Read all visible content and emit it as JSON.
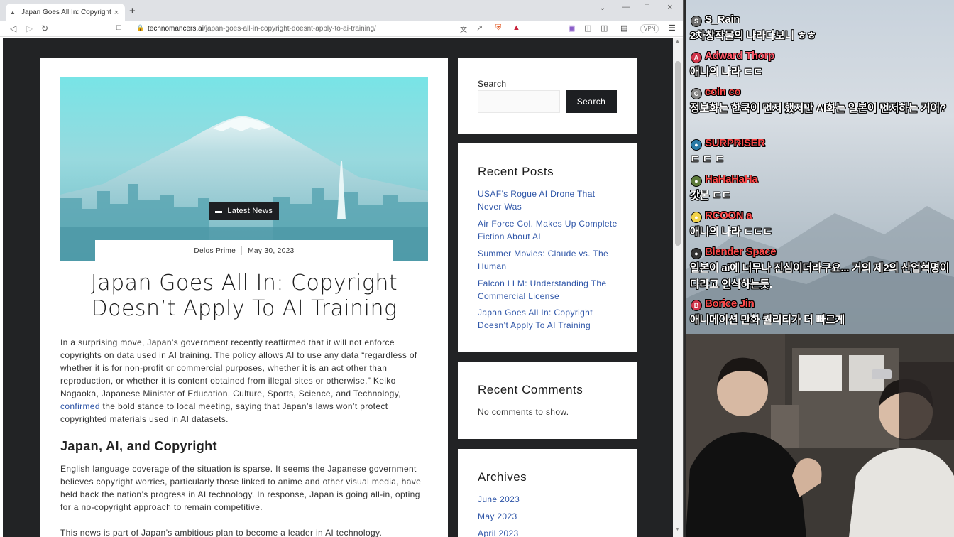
{
  "browser": {
    "tab_title": "Japan Goes All In: Copyright Doesn't Apply to AI Training",
    "new_tab_label": "+",
    "url_domain": "technomancers.ai",
    "url_path": "/japan-goes-all-in-copyright-doesnt-apply-to-ai-training/",
    "vpn_label": "VPN"
  },
  "article": {
    "category": "Latest News",
    "author": "Delos Prime",
    "date": "May 30, 2023",
    "title": "Japan Goes All In: Copyright Doesn’t Apply To AI Training",
    "p1_before_link": "In a surprising move, Japan’s government recently reaffirmed that it will not enforce copyrights on data used in AI training. The policy allows AI to use any data “regardless of whether it is for non-profit or commercial purposes, whether it is an act other than reproduction, or whether it is content obtained from illegal sites or otherwise.” Keiko Nagaoka, Japanese Minister of Education, Culture, Sports, Science, and Technology, ",
    "p1_link": "confirmed",
    "p1_after_link": " the bold stance to local meeting, saying that Japan’s laws won’t protect copyrighted materials used in AI datasets.",
    "h2": "Japan, AI, and Copyright",
    "p2": "English language coverage of the situation is sparse. It seems the Japanese government believes copyright worries, particularly those linked to anime and other visual media, have held back the nation’s progress in AI technology. In response, Japan is going all-in, opting for a no-copyright approach to remain competitive.",
    "p3": "This news is part of Japan’s ambitious plan to become a leader in AI technology."
  },
  "sidebar": {
    "search_label": "Search",
    "search_button": "Search",
    "search_placeholder": "",
    "recent_posts_title": "Recent Posts",
    "recent_posts": [
      "USAF’s Rogue AI Drone That Never Was",
      "Air Force Col. Makes Up Complete Fiction About AI",
      "Summer Movies: Claude vs. The Human",
      "Falcon LLM: Understanding The Commercial License",
      "Japan Goes All In: Copyright Doesn’t Apply To AI Training"
    ],
    "recent_comments_title": "Recent Comments",
    "recent_comments_text": "No comments to show.",
    "archives_title": "Archives",
    "archives": [
      "June 2023",
      "May 2023",
      "April 2023"
    ]
  },
  "chat": [
    {
      "avatar": "S",
      "avatar_color": "#6b6b6b",
      "name": "S_Rain",
      "name_color": "#ffffff",
      "msg": "2차창작물의 나라다보니 ㅎㅎ"
    },
    {
      "avatar": "A",
      "avatar_color": "#d0354b",
      "name": "Adward Thorp",
      "name_color": "#ff5a6a",
      "msg": "애니의 나라 ㄷㄷ"
    },
    {
      "avatar": "C",
      "avatar_color": "#888888",
      "name": "coin co",
      "name_color": "#ff4a4a",
      "msg": "정보화는 한국이 먼저 했지만 AI화는 일본이 먼저하는 거어?"
    },
    {
      "avatar": "●",
      "avatar_color": "#2a7aa6",
      "name": "SURPRISER",
      "name_color": "#ff4a4a",
      "msg": "ㄷ ㄷ ㄷ"
    },
    {
      "avatar": "●",
      "avatar_color": "#5c7a3a",
      "name": "HaHaHaHa",
      "name_color": "#ff4a4a",
      "msg": "갓본 ㄷㄷ"
    },
    {
      "avatar": "●",
      "avatar_color": "#f2d34a",
      "name": "RCOON a",
      "name_color": "#ff4a4a",
      "msg": "애니의 나라 ㄷㄷㄷ"
    },
    {
      "avatar": "●",
      "avatar_color": "#333333",
      "name": "Blender Space",
      "name_color": "#ff4a4a",
      "msg": "일본이 ai에 너무나 진심이더라구요... 거의 제2의 산업혁명이다라고 인식하는듯."
    },
    {
      "avatar": "B",
      "avatar_color": "#d0354b",
      "name": "Borice Jin",
      "name_color": "#ff4a4a",
      "msg": "애니메이션 만화 퀄리티가 더 빠르게"
    }
  ]
}
